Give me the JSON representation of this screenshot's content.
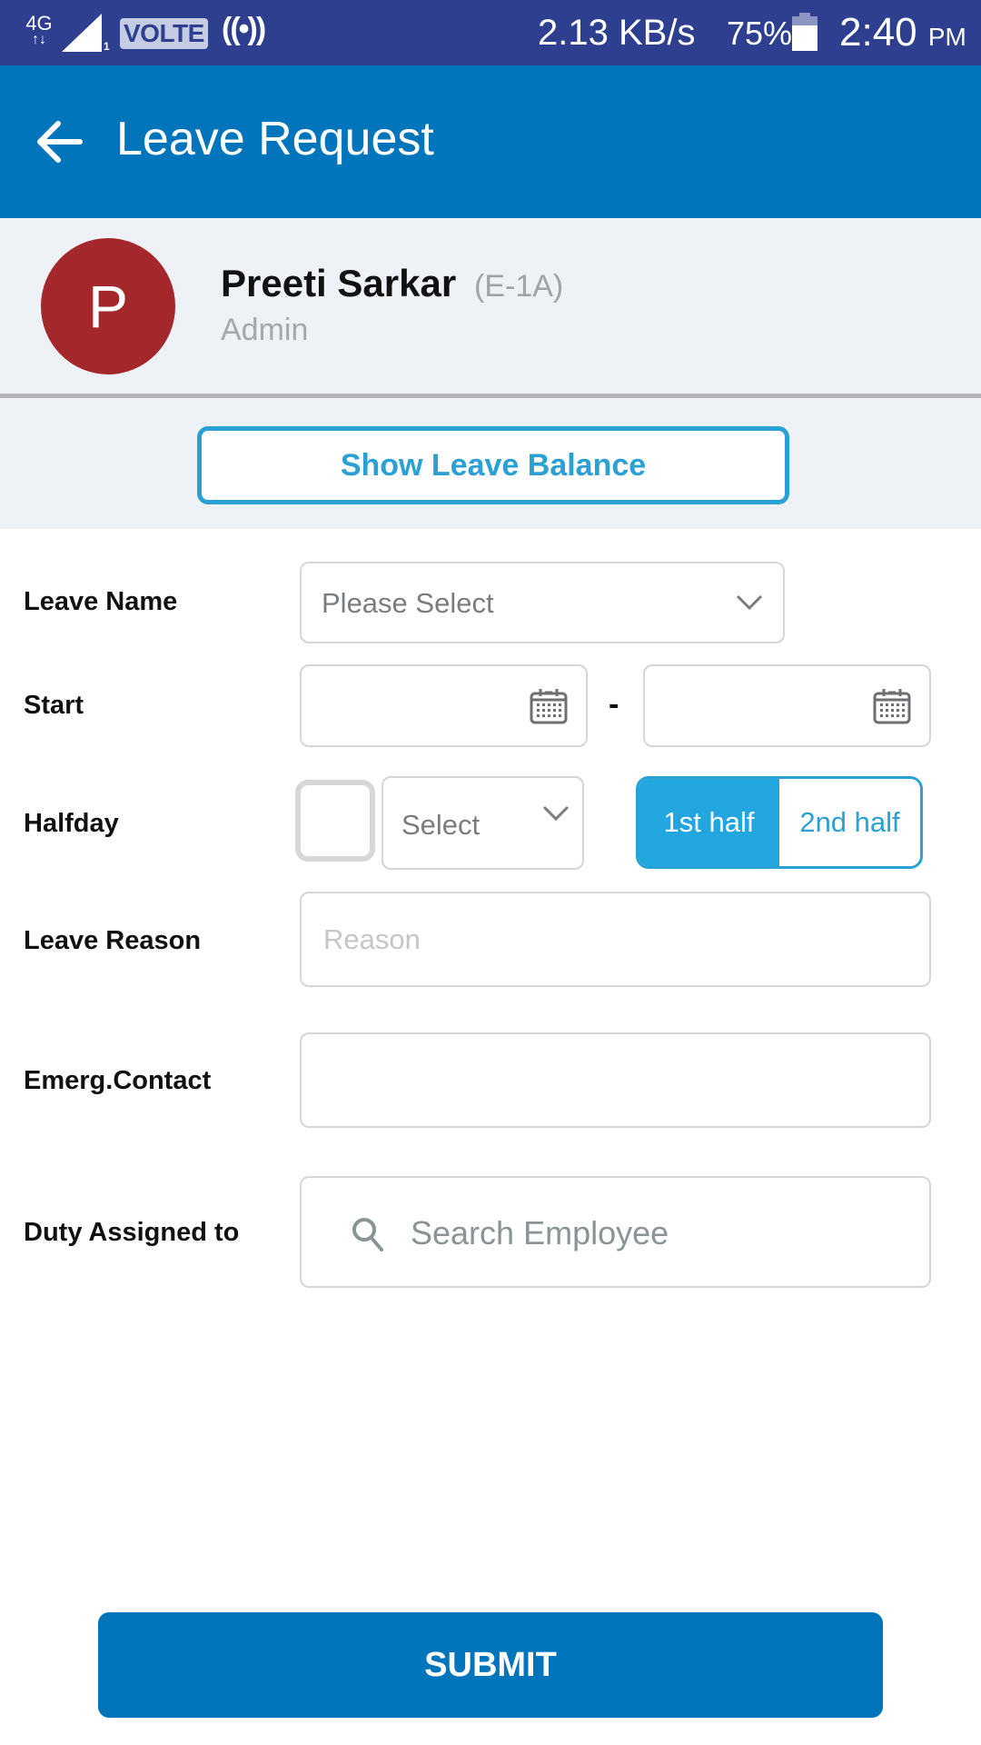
{
  "status_bar": {
    "network_type": "4G",
    "network_arrows": "↑↓",
    "sim_slot": "1",
    "volte": "VOLTE",
    "hotspot_icon": "((•))",
    "data_speed": "2.13 KB/s",
    "battery_percent_label": "75%",
    "battery_level": 0.75,
    "time": "2:40",
    "ampm": "PM"
  },
  "app_bar": {
    "title": "Leave Request",
    "back_icon": "arrow-left"
  },
  "profile": {
    "avatar_initial": "P",
    "name": "Preeti Sarkar",
    "employee_code": "(E-1A)",
    "role": "Admin"
  },
  "balance_button": {
    "label": "Show Leave Balance"
  },
  "form": {
    "leave_name": {
      "label": "Leave Name",
      "value": "Please Select"
    },
    "start": {
      "label": "Start",
      "start_value": "",
      "end_value": "",
      "separator": "-"
    },
    "halfday": {
      "label": "Halfday",
      "checked": false,
      "select_value": "Select",
      "options": [
        {
          "label": "1st half",
          "selected": true
        },
        {
          "label": "2nd half",
          "selected": false
        }
      ]
    },
    "leave_reason": {
      "label": "Leave Reason",
      "placeholder": "Reason",
      "value": ""
    },
    "emergency_contact": {
      "label": "Emerg.Contact",
      "value": ""
    },
    "duty_assigned": {
      "label": "Duty Assigned to",
      "placeholder": "Search Employee"
    }
  },
  "submit": {
    "label": "SUBMIT"
  },
  "colors": {
    "status_bar": "#2e3f8f",
    "primary": "#0075bb",
    "accent": "#2aa0d3",
    "avatar": "#a4282b",
    "profile_bg": "#eef1f6"
  }
}
